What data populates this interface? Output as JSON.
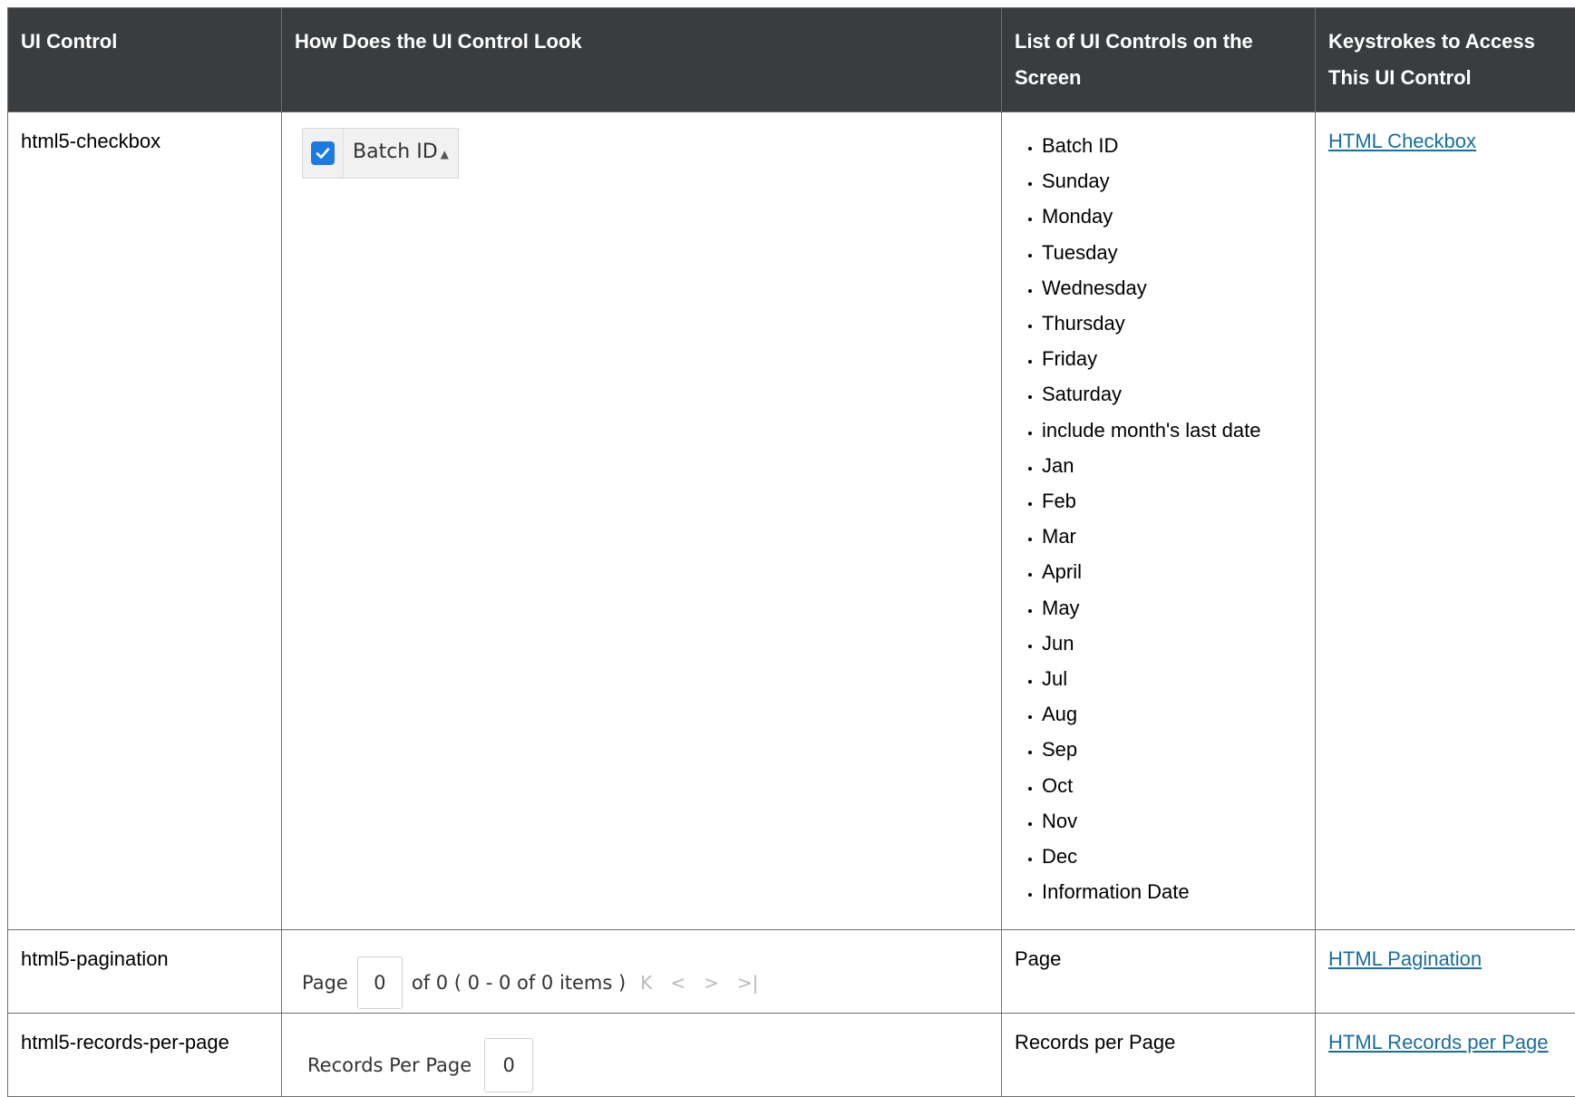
{
  "headers": [
    "UI Control",
    "How Does the UI Control Look",
    "List of UI Controls on the Screen",
    "Keystrokes to Access This UI Control"
  ],
  "rows": {
    "checkbox": {
      "control": "html5-checkbox",
      "sample_label": "Batch ID",
      "sort_glyph": "▲",
      "controls": [
        "Batch ID",
        "Sunday",
        "Monday",
        "Tuesday",
        "Wednesday",
        "Thursday",
        "Friday",
        "Saturday",
        "include month's last date",
        "Jan",
        "Feb",
        "Mar",
        "April",
        "May",
        "Jun",
        "Jul",
        "Aug",
        "Sep",
        "Oct",
        "Nov",
        "Dec",
        "Information Date"
      ],
      "link": "HTML Checkbox"
    },
    "pagination": {
      "control": "html5-pagination",
      "sample": {
        "page_label": "Page",
        "page_value": "0",
        "summary": "of 0 ( 0 - 0 of 0 items )",
        "nav_icons": [
          "first-page-icon",
          "prev-page-icon",
          "next-page-icon",
          "last-page-icon"
        ]
      },
      "controls": "Page",
      "link": "HTML Pagination"
    },
    "records": {
      "control": "html5-records-per-page",
      "sample": {
        "label": "Records Per Page",
        "value": "0"
      },
      "controls": "Records per Page",
      "link": "HTML Records per Page"
    }
  },
  "colors": {
    "header_bg": "#3a3d3f",
    "link": "#1b6e9b",
    "checkbox_blue": "#1c7be3"
  }
}
